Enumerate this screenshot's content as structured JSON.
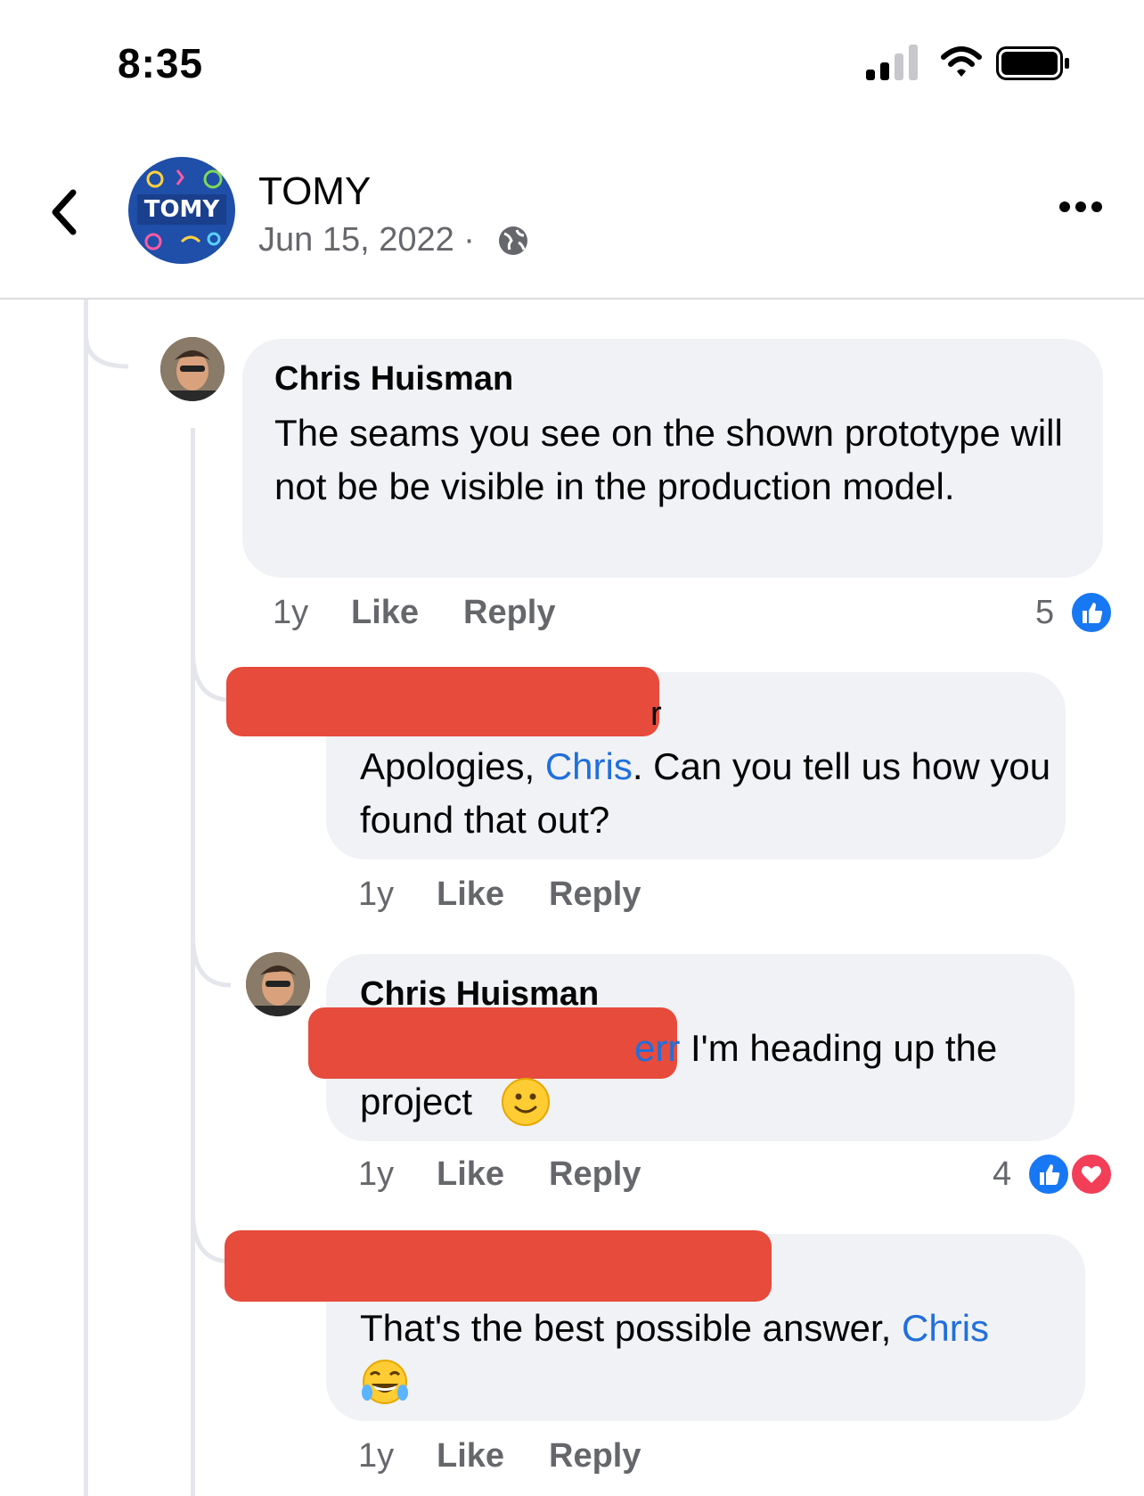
{
  "status_bar": {
    "time": "8:35"
  },
  "header": {
    "page_name": "TOMY",
    "date": "Jun 15, 2022 ·",
    "avatar_logo_text": "TOMY"
  },
  "comments": [
    {
      "author": "Chris Huisman",
      "text": "The seams you see on the shown prototype will not be be visible in the production model.",
      "time": "1y",
      "like_label": "Like",
      "reply_label": "Reply",
      "reaction_count": "5"
    },
    {
      "author": "",
      "author_fragment": "r",
      "text_before": "Apologies, ",
      "mention": "Chris",
      "text_after": ". Can you tell us how you found that out?",
      "time": "1y",
      "like_label": "Like",
      "reply_label": "Reply"
    },
    {
      "author": "Chris Huisman",
      "mention_fragment": "err",
      "text": " I'm heading up the",
      "text_line2": "project",
      "time": "1y",
      "like_label": "Like",
      "reply_label": "Reply",
      "reaction_count": "4"
    },
    {
      "author": "",
      "text_before": "That's the best possible answer, ",
      "mention": "Chris",
      "time": "1y",
      "like_label": "Like",
      "reply_label": "Reply"
    }
  ],
  "icons": {
    "back": "chevron-left-icon",
    "more": "more-horizontal-icon",
    "globe": "globe-icon",
    "like_reaction": "like-reaction-icon",
    "love_reaction": "love-reaction-icon",
    "smile": "slightly-smiling-emoji",
    "laugh": "tears-of-joy-emoji"
  },
  "colors": {
    "mention": "#216fdb",
    "redaction": "#e64b3c",
    "bubble": "#f0f2f5",
    "like": "#1877f2",
    "love": "#f33e58"
  }
}
